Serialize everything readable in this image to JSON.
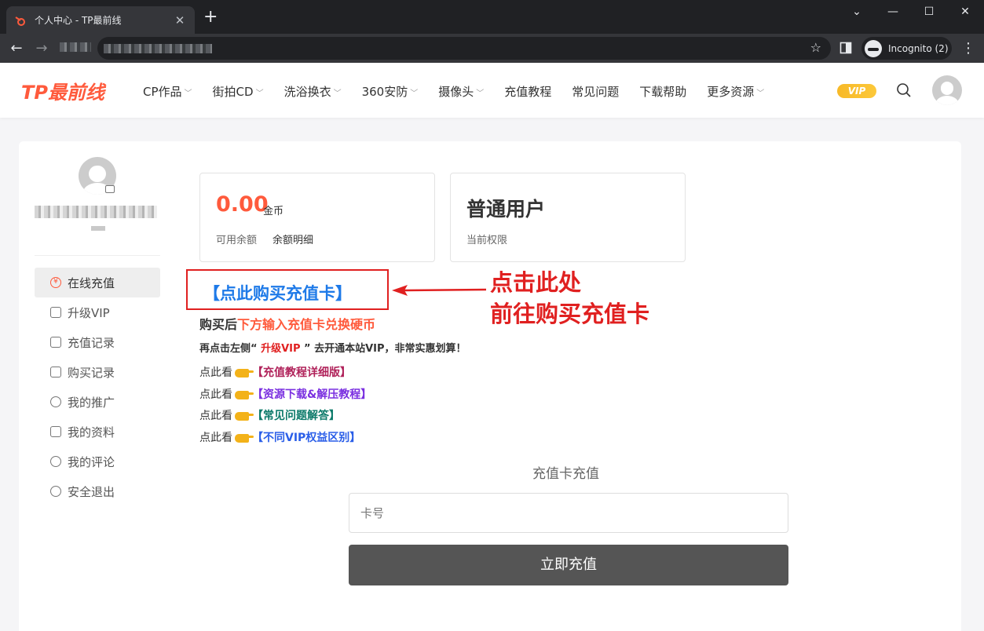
{
  "browser": {
    "tab_title": "个人中心 - TP最前线",
    "tab_close": "✕",
    "new_tab": "+",
    "window_controls": {
      "minimize": "⌄",
      "restore": "—",
      "maximize": "☐",
      "close": "✕"
    },
    "incognito_label": "Incognito (2)",
    "menu_icon": "⋮"
  },
  "site": {
    "logo": "TP最前线",
    "nav": [
      {
        "label": "CP作品",
        "has_dropdown": true
      },
      {
        "label": "街拍CD",
        "has_dropdown": true
      },
      {
        "label": "洗浴换衣",
        "has_dropdown": true
      },
      {
        "label": "360安防",
        "has_dropdown": true
      },
      {
        "label": "摄像头",
        "has_dropdown": true
      },
      {
        "label": "充值教程",
        "has_dropdown": false
      },
      {
        "label": "常见问题",
        "has_dropdown": false
      },
      {
        "label": "下载帮助",
        "has_dropdown": false
      },
      {
        "label": "更多资源",
        "has_dropdown": true
      }
    ],
    "vip_badge": "VIP",
    "brand_color": "#ff5a3c"
  },
  "sidebar": {
    "menu": [
      {
        "label": "在线充值",
        "icon": "yen-icon",
        "active": true
      },
      {
        "label": "升级VIP",
        "icon": "crown-icon",
        "active": false
      },
      {
        "label": "充值记录",
        "icon": "wallet-icon",
        "active": false
      },
      {
        "label": "购买记录",
        "icon": "bag-icon",
        "active": false
      },
      {
        "label": "我的推广",
        "icon": "share-icon",
        "active": false
      },
      {
        "label": "我的资料",
        "icon": "id-card-icon",
        "active": false
      },
      {
        "label": "我的评论",
        "icon": "comment-icon",
        "active": false
      },
      {
        "label": "安全退出",
        "icon": "power-icon",
        "active": false
      }
    ]
  },
  "balance": {
    "amount": "0.00",
    "unit": "金币",
    "label": "可用余额",
    "detail_link": "余额明细"
  },
  "role": {
    "name": "普通用户",
    "label": "当前权限"
  },
  "promo": {
    "buy_link": "【点此购买充值卡】",
    "annotation_line1": "点击此处",
    "annotation_line2": "前往购买充值卡",
    "after_prefix": "购买后",
    "after_highlight": "下方输入充值卡兑换硬币",
    "tip_prefix": "再点击左侧“ ",
    "tip_highlight": "升级VIP",
    "tip_suffix": " ” 去开通本站VIP，非常实惠划算！",
    "see_prefix": "点此看",
    "links": [
      {
        "text": "【充值教程详细版】",
        "color": "#b0225a"
      },
      {
        "text": "【资源下载&解压教程】",
        "color": "#7a2fe0"
      },
      {
        "text": "【常见问题解答】",
        "color": "#0c7a6a"
      },
      {
        "text": "【不同VIP权益区别】",
        "color": "#2a5ee8"
      }
    ]
  },
  "recharge": {
    "title": "充值卡充值",
    "placeholder": "卡号",
    "value": "",
    "submit_label": "立即充值"
  }
}
